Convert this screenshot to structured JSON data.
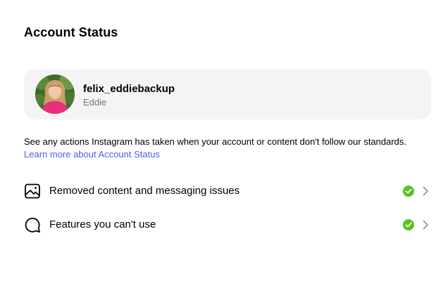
{
  "header": {
    "title": "Account Status"
  },
  "account": {
    "username": "felix_eddiebackup",
    "display_name": "Eddie"
  },
  "description": {
    "text": "See any actions Instagram has taken when your account or content don't follow our standards. ",
    "link_label": "Learn more about Account Status"
  },
  "status_items": [
    {
      "label": "Removed content and messaging issues",
      "icon": "image-icon",
      "status": "ok"
    },
    {
      "label": "Features you can't use",
      "icon": "chat-bubble-icon",
      "status": "ok"
    }
  ],
  "colors": {
    "link": "#4a5df9",
    "status_ok": "#58c322",
    "card_background": "#f4f4f5",
    "secondary_text": "#737373"
  }
}
